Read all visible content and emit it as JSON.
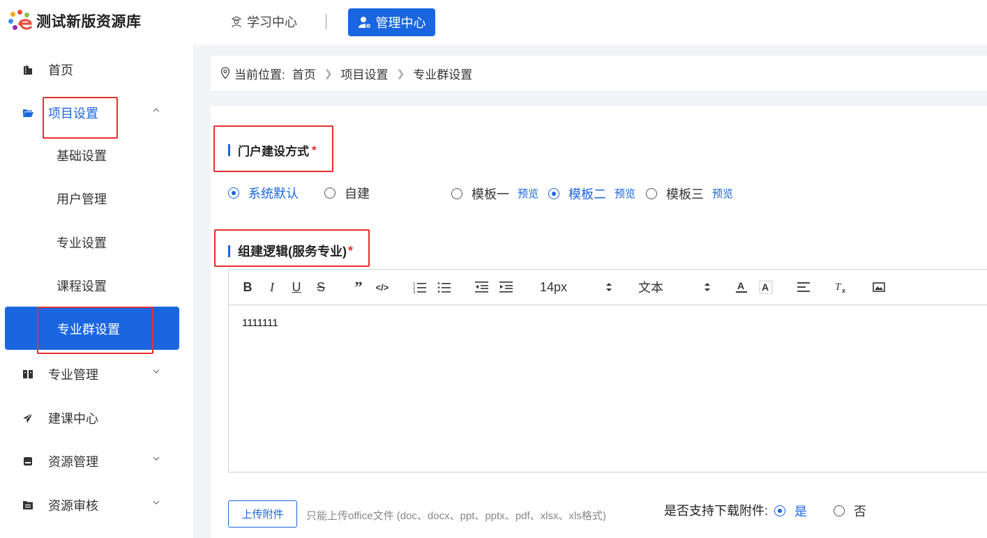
{
  "app": {
    "title": "测试新版资源库",
    "colors": {
      "primary": "#1a66e0",
      "highlight": "#e62e2e"
    }
  },
  "header": {
    "nav": [
      {
        "label": "学习中心",
        "icon": "user-hat-icon",
        "active": false
      },
      {
        "label": "管理中心",
        "icon": "user-gear-icon",
        "active": true
      }
    ]
  },
  "sidebar": {
    "items": [
      {
        "label": "首页",
        "icon": "building-icon"
      },
      {
        "label": "项目设置",
        "icon": "folder-open-icon",
        "expanded": true,
        "children": [
          "基础设置",
          "用户管理",
          "专业设置",
          "课程设置",
          "专业群设置"
        ],
        "active_child": "专业群设置"
      },
      {
        "label": "专业管理",
        "icon": "book-icon",
        "expandable": true
      },
      {
        "label": "建课中心",
        "icon": "paper-plane-icon"
      },
      {
        "label": "资源管理",
        "icon": "drive-icon",
        "expandable": true
      },
      {
        "label": "资源审核",
        "icon": "file-list-icon",
        "expandable": true
      }
    ]
  },
  "breadcrumb": {
    "prefix": "当前位置:",
    "items": [
      "首页",
      "项目设置",
      "专业群设置"
    ]
  },
  "portal": {
    "title": "门户建设方式",
    "required_mark": "*",
    "options": [
      {
        "label": "系统默认",
        "checked": true
      },
      {
        "label": "自建",
        "checked": false
      }
    ],
    "templates": [
      {
        "label": "模板一",
        "preview": "预览",
        "checked": false
      },
      {
        "label": "模板二",
        "preview": "预览",
        "checked": true
      },
      {
        "label": "模板三",
        "preview": "预览",
        "checked": false
      }
    ]
  },
  "logic": {
    "title": "组建逻辑(服务专业)",
    "required_mark": "*"
  },
  "editor": {
    "font_size": "14px",
    "block_type": "文本",
    "content": "1111111",
    "tools": [
      "bold-icon",
      "italic-icon",
      "underline-icon",
      "strikethrough-icon",
      "blockquote-icon",
      "code-icon",
      "ordered-list-icon",
      "bullet-list-icon",
      "outdent-icon",
      "indent-icon",
      "font-color-icon",
      "background-color-icon",
      "align-icon",
      "clear-format-icon",
      "image-icon"
    ]
  },
  "attachment": {
    "upload_label": "上传附件",
    "hint": "只能上传office文件 (doc、docx、ppt、pptx、pdf、xlsx、xls格式)",
    "download_label": "是否支持下载附件:",
    "options": [
      {
        "label": "是",
        "checked": true
      },
      {
        "label": "否",
        "checked": false
      }
    ]
  }
}
